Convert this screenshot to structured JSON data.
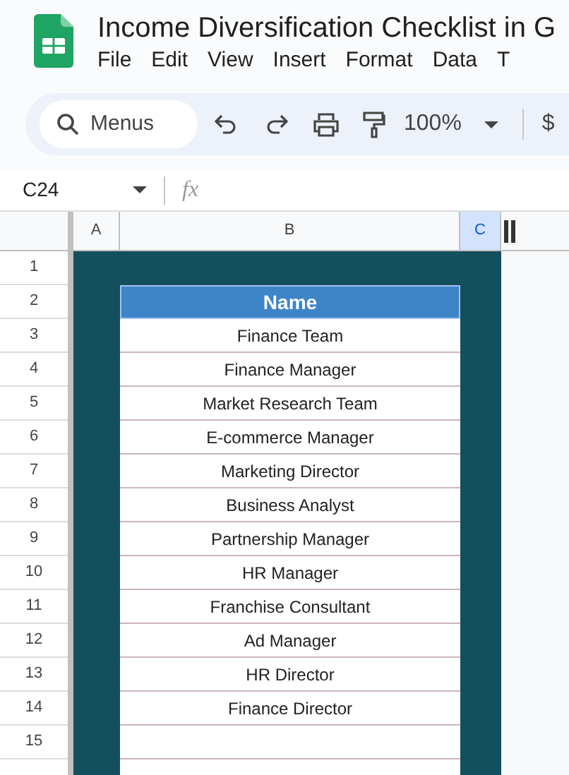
{
  "document": {
    "title": "Income Diversification Checklist in G",
    "menu": [
      "File",
      "Edit",
      "View",
      "Insert",
      "Format",
      "Data",
      "T"
    ]
  },
  "toolbar": {
    "search": "Menus",
    "zoom": "100%",
    "currency": "$"
  },
  "formula_bar": {
    "cell_ref": "C24",
    "fx": "fx"
  },
  "columns": [
    {
      "label": "A",
      "selected": false
    },
    {
      "label": "B",
      "selected": false
    },
    {
      "label": "C",
      "selected": true
    }
  ],
  "row_numbers": [
    "1",
    "2",
    "3",
    "4",
    "5",
    "6",
    "7",
    "8",
    "9",
    "10",
    "11",
    "12",
    "13",
    "14",
    "15"
  ],
  "table": {
    "header": "Name",
    "rows": [
      "Finance Team",
      "Finance Manager",
      "Market Research Team",
      "E-commerce Manager",
      "Marketing Director",
      "Business Analyst",
      "Partnership Manager",
      "HR Manager",
      "Franchise Consultant",
      "Ad Manager",
      "HR Director",
      "Finance Director",
      ""
    ]
  }
}
